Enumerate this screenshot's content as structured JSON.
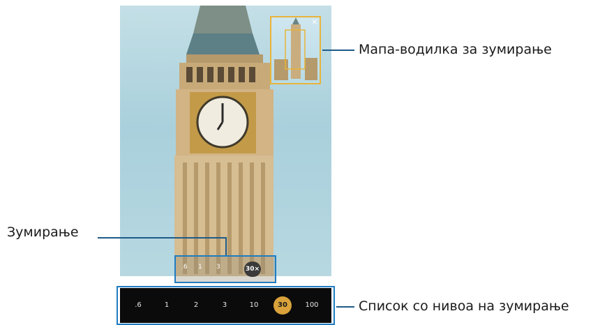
{
  "callouts": {
    "zoom_guide_map": "Мапа-водилка за зумирање",
    "zoom": "Зумирање",
    "zoom_level_list": "Список со нивоа на зумирање"
  },
  "zoom_control": {
    "levels": [
      ".6",
      "1",
      "3"
    ],
    "current": "30×"
  },
  "zoom_bar": {
    "levels": [
      ".6",
      "1",
      "2",
      "3",
      "10",
      "30",
      "100"
    ],
    "active": "30"
  },
  "colors": {
    "highlight_frame": "#1f7cc2",
    "leader_line": "#1f5b88",
    "active_zoom": "#d9a23a",
    "minimap_frame": "#e8b43a"
  },
  "icons": [
    "minimap-close-icon"
  ]
}
